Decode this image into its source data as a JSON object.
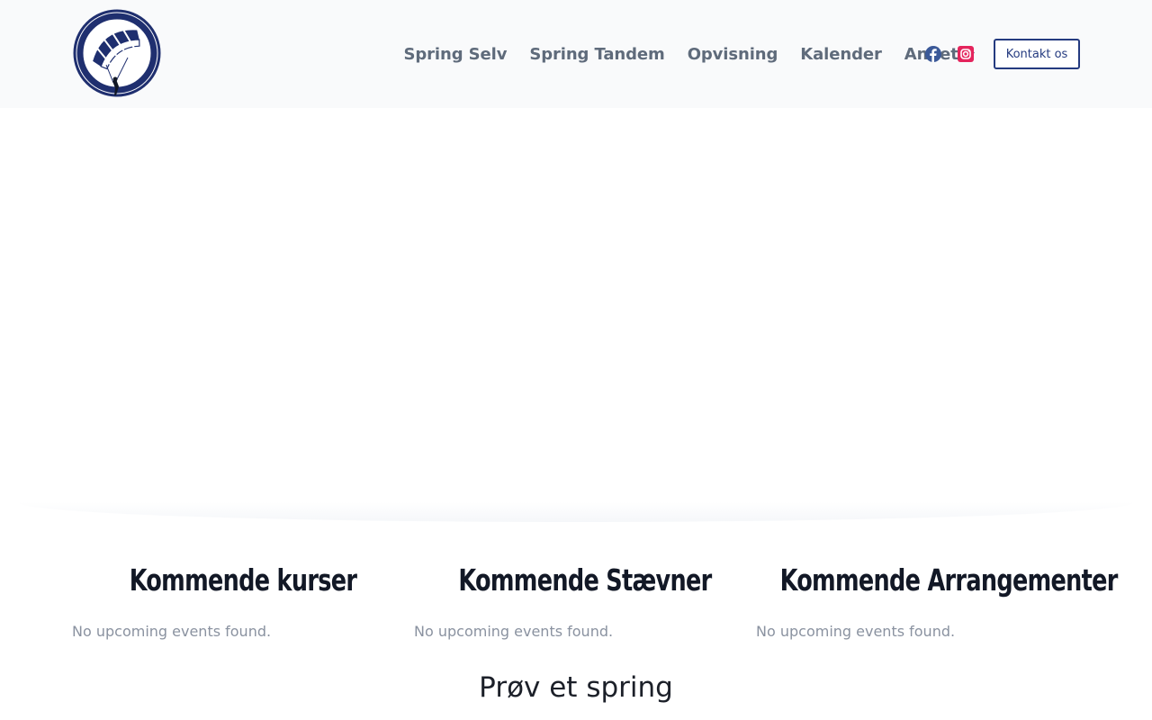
{
  "header": {
    "logo_icon": "parachute-club-logo",
    "nav": [
      {
        "label": "Spring Selv"
      },
      {
        "label": "Spring Tandem"
      },
      {
        "label": "Opvisning"
      },
      {
        "label": "Kalender"
      },
      {
        "label": "Andet",
        "has_dropdown": true
      }
    ],
    "socials": [
      {
        "icon": "facebook-icon",
        "color": "#3b5998"
      },
      {
        "icon": "instagram-icon",
        "color": "#e4245c"
      }
    ],
    "contact_label": "Kontakt os"
  },
  "events": {
    "columns": [
      {
        "title": "Kommende kurser",
        "empty_text": "No upcoming events found."
      },
      {
        "title": "Kommende Stævner",
        "empty_text": "No upcoming events found."
      },
      {
        "title": "Kommende Arrangementer",
        "empty_text": "No upcoming events found."
      }
    ]
  },
  "try_section": {
    "title": "Prøv et spring",
    "subtitle": ""
  },
  "colors": {
    "accent": "#253b80",
    "nav_text": "#5f6b7b",
    "header_bg": "#f9fafb"
  }
}
